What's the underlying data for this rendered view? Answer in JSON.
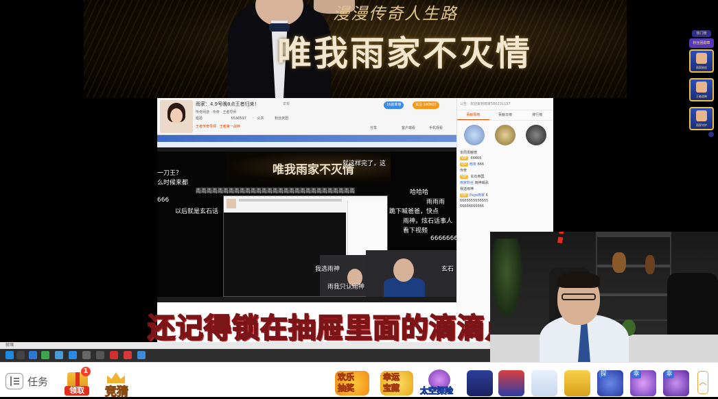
{
  "banner": {
    "subtitle": "漫漫传奇人生路",
    "title": "唯我雨家不灭情"
  },
  "inner_browser": {
    "stream_title": "雨家：4.9号晚8点王者归来！",
    "tag": "举报",
    "follow_button": "关注",
    "follow_count": "140607",
    "badge_button": "16勋章墙",
    "row2": "传奇网游 · 传奇 · 王者导师",
    "row3_items": [
      "经验",
      "6530597",
      "公共",
      "粉丝天团"
    ],
    "row4": "王者传奇导师 · 王者第一战神",
    "share": "分享",
    "client": "客户端看",
    "download": "手机观看",
    "inner_title": "唯我雨家不灭情",
    "side_header": "公告：欢迎来到雨家586231197",
    "side_tabs": [
      "贡献周榜",
      "贡献日榜",
      "排行榜"
    ],
    "chat_lines": [
      {
        "user": "",
        "text": "本周贡献榜"
      },
      {
        "user": "",
        "text": "66666"
      },
      {
        "user": "暗夜",
        "text": "666"
      },
      {
        "user": "",
        "text": "传奇"
      },
      {
        "user": "",
        "text": "玄石帝国"
      },
      {
        "user": "雨家粉丝",
        "text": "雨神威武"
      },
      {
        "user": "",
        "text": "我选雨神"
      },
      {
        "user": "Page雨家",
        "text": "6"
      },
      {
        "user": "",
        "text": "6665555555555"
      },
      {
        "user": "",
        "text": "66666666666"
      }
    ],
    "danmu": [
      "一刀王？",
      "么时候来都",
      "雨雨雨雨雨雨雨雨雨雨雨雨雨雨雨雨雨雨雨雨雨雨雨雨雨雨雨雨雨",
      "哈哈哈",
      "666",
      "以后就是玄石话",
      "雨雨雨",
      "就这样完了，这",
      "跪下喊爸爸，快点",
      "雨神，炫石话事人",
      "看下视频",
      "6666666",
      "我选雨神",
      "雨我只认雨神",
      "玄石"
    ]
  },
  "subtitle": "还记得锁在抽屉里面的滴滴点",
  "desktop_taskbar": {
    "status_text": "就绪"
  },
  "gift_sidebar": {
    "label": "热门榜",
    "strip": "粉丝团勋章",
    "cards": [
      "雨家粉丝",
      "王者战神",
      "雨家守护"
    ]
  },
  "bottom_bar": {
    "task_label": "任务",
    "lingqu_label": "领取",
    "lingqu_count": "1",
    "jingcai_label": "竞猜",
    "games": [
      {
        "top": "欢乐",
        "bottom": "抽奖"
      },
      {
        "top": "幸运",
        "bottom": "宝藏"
      },
      {
        "top": "",
        "bottom": "太空探险"
      }
    ],
    "gift_badges": [
      "探",
      "幸",
      "幸"
    ],
    "colors": {
      "accent": "#e0301e",
      "gold": "#f2b632",
      "blue": "#3b6ed8"
    }
  }
}
